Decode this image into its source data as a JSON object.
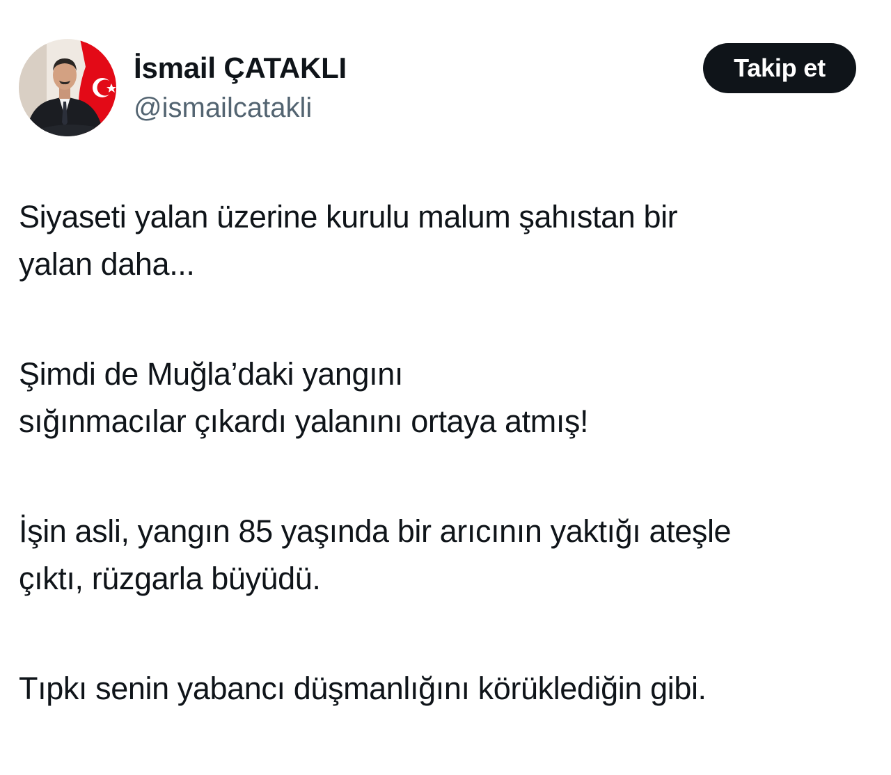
{
  "author": {
    "display_name": "İsmail ÇATAKLI",
    "handle": "@ismailcatakli",
    "avatar_icon": "profile-photo"
  },
  "actions": {
    "follow_label": "Takip et"
  },
  "tweet": {
    "paragraphs": [
      [
        "Siyaseti yalan üzerine kurulu malum şahıstan bir",
        "yalan daha..."
      ],
      [
        "Şimdi de Muğla’daki yangını",
        "sığınmacılar çıkardı yalanını ortaya atmış!"
      ],
      [
        "İşin asli, yangın 85 yaşında bir arıcının yaktığı ateşle",
        "çıktı, rüzgarla büyüdü."
      ],
      [
        "Tıpkı senin yabancı düşmanlığını körüklediğin gibi."
      ]
    ]
  },
  "colors": {
    "text": "#0f1419",
    "secondary_text": "#536471",
    "button_bg": "#0f1419",
    "button_text": "#ffffff",
    "flag_red": "#e30a17"
  }
}
